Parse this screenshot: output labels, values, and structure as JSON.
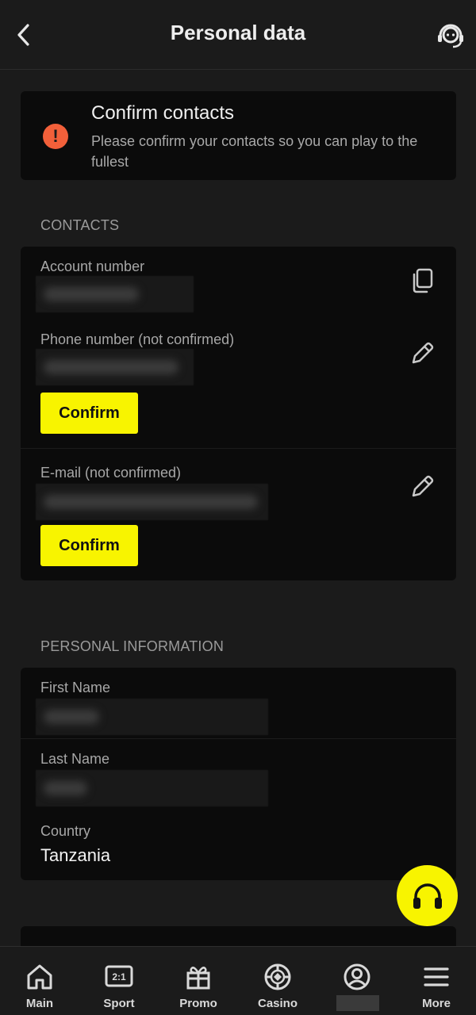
{
  "header": {
    "title": "Personal data",
    "back_icon": "chevron-left-icon",
    "support_icon": "headset-icon"
  },
  "alert": {
    "title": "Confirm contacts",
    "text": "Please confirm your contacts so you can play to the fullest",
    "icon": "exclamation-icon",
    "icon_color": "#f2603a"
  },
  "contacts": {
    "section_label": "CONTACTS",
    "account_label": "Account number",
    "phone_label": "Phone number (not confirmed)",
    "email_label": "E-mail (not confirmed)",
    "confirm_label": "Confirm",
    "copy_icon": "copy-icon",
    "edit_icon": "pencil-icon"
  },
  "personal": {
    "section_label": "PERSONAL INFORMATION",
    "first_name_label": "First Name",
    "last_name_label": "Last Name",
    "country_label": "Country",
    "country_value": "Tanzania"
  },
  "fab_icon": "headphones-icon",
  "accent_color": "#f8f400",
  "nav": {
    "items": [
      {
        "label": "Main",
        "icon": "home-icon"
      },
      {
        "label": "Sport",
        "icon": "scoreboard-icon"
      },
      {
        "label": "Promo",
        "icon": "gift-icon"
      },
      {
        "label": "Casino",
        "icon": "casino-chip-icon"
      },
      {
        "label": "",
        "icon": "profile-icon"
      },
      {
        "label": "More",
        "icon": "menu-icon"
      }
    ]
  }
}
